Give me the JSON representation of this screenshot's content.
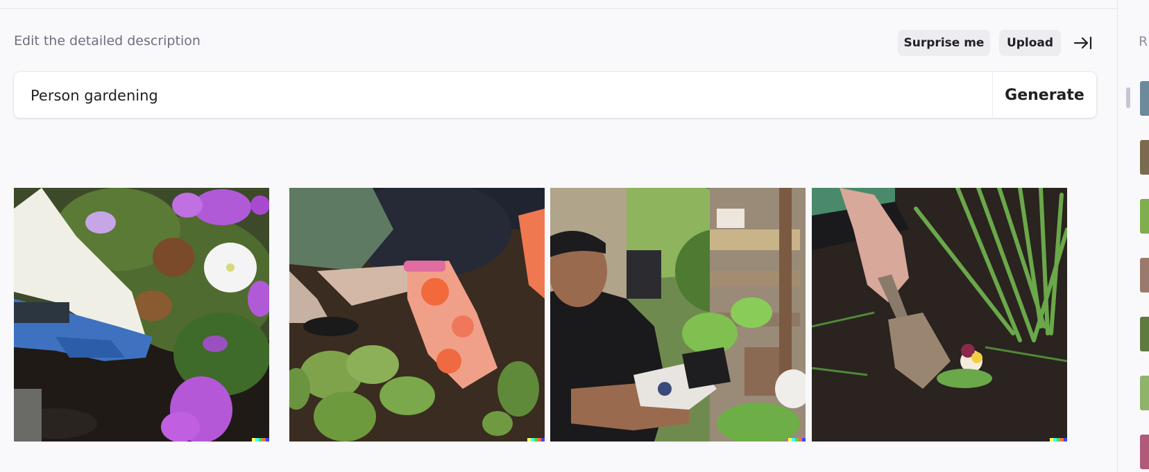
{
  "header": {
    "instruction": "Edit the detailed description",
    "surprise_label": "Surprise me",
    "upload_label": "Upload"
  },
  "prompt": {
    "value": "Person gardening",
    "generate_label": "Generate"
  },
  "gallery": {
    "images": [
      {
        "subject": "gloved hand planting among purple and white petunias"
      },
      {
        "subject": "hands in orange polka-dot gloves weeding soil"
      },
      {
        "subject": "man in black shirt holding a potted seedling"
      },
      {
        "subject": "hand digging with trowel next to a pansy"
      }
    ],
    "signature_colors": [
      "#ffff66",
      "#42ffff",
      "#51da4c",
      "#ff6e3c",
      "#3c46ff"
    ]
  },
  "right_panel": {
    "title": "R",
    "thumb_colors": [
      "#6b8a9a",
      "#7a6a4e",
      "#7fae4c",
      "#9a7a6a",
      "#5e7a3e",
      "#8fb36a",
      "#b05a7a"
    ]
  }
}
